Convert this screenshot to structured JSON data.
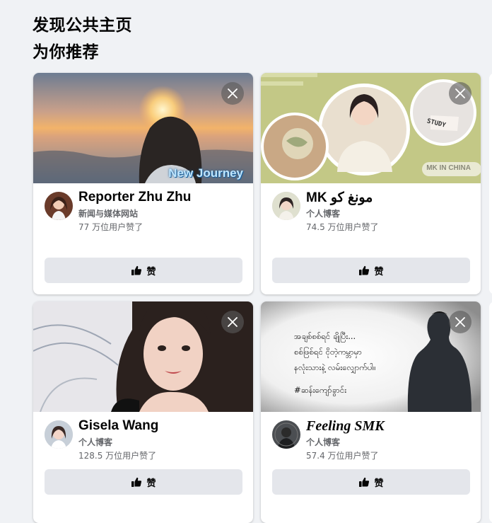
{
  "section": {
    "title": "发现公共主页",
    "subtitle": "为你推荐"
  },
  "cards": [
    {
      "name": "Reporter Zhu Zhu",
      "category": "新闻与媒体网站",
      "likes": "77 万位用户赞了",
      "like_label": "赞",
      "cover_overlay_text": "New Journey"
    },
    {
      "name": "MK مونغ کو",
      "category": "个人博客",
      "likes": "74.5 万位用户赞了",
      "like_label": "赞",
      "cover_overlay_text": "MK IN CHINA",
      "cover_badge_text": "STUDY"
    },
    {
      "name": "Gisela Wang",
      "category": "个人博客",
      "likes": "128.5 万位用户赞了",
      "like_label": "赞"
    },
    {
      "name": "Feeling SMK",
      "category": "个人博客",
      "likes": "57.4 万位用户赞了",
      "like_label": "赞",
      "cover_lines": [
        "အချစ်စစ်ရင် ချိုပြီး...",
        "စစ်ဖြစ်ရင် ငိုတဲ့ကမ္ဘာမှာ",
        "နလုံးသားနဲ့ လမ်းလျှောက်ပါ။",
        "#ဆန်းကျော်ခွာင်း"
      ]
    }
  ],
  "icons": {
    "close": "close-icon",
    "like": "thumbs-up-icon"
  },
  "colors": {
    "background": "#f0f2f5",
    "button": "#e4e6eb",
    "secondary_text": "#65676b"
  }
}
